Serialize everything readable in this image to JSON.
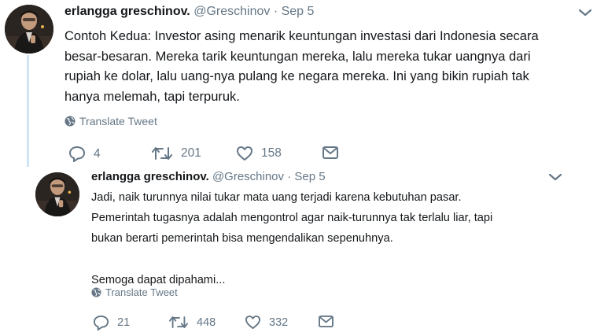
{
  "tweets": [
    {
      "name": "erlangga greschinov.",
      "handle": "@Greschinov",
      "separator": "·",
      "date": "Sep 5",
      "lines": [
        "Contoh Kedua: Investor asing menarik keuntungan investasi dari Indonesia secara",
        "besar-besaran. Mereka tarik keuntungan mereka, lalu mereka tukar uangnya dari",
        "rupiah ke dolar, lalu uang-nya pulang ke negara mereka. Ini yang bikin rupiah tak",
        "hanya melemah, tapi terpuruk."
      ],
      "translate_label": "Translate Tweet",
      "replies": "4",
      "retweets": "201",
      "likes": "158"
    },
    {
      "name": "erlangga greschinov.",
      "handle": "@Greschinov",
      "separator": "·",
      "date": "Sep 5",
      "lines": [
        "Jadi, naik turunnya nilai tukar mata uang terjadi karena kebutuhan pasar.",
        "Pemerintah tugasnya adalah mengontrol agar naik-turunnya tak terlalu liar, tapi",
        "bukan berarti pemerintah bisa mengendalikan sepenuhnya.",
        "",
        "Semoga dapat dipahami..."
      ],
      "translate_label": "Translate Tweet",
      "replies": "21",
      "retweets": "448",
      "likes": "332"
    }
  ],
  "colors": {
    "text": "#14171a",
    "secondary": "#657786",
    "thread_line": "#cfe4f4"
  },
  "icons": [
    "chevron-down-icon",
    "globe-icon",
    "reply-icon",
    "retweet-icon",
    "like-icon",
    "direct-message-icon"
  ]
}
